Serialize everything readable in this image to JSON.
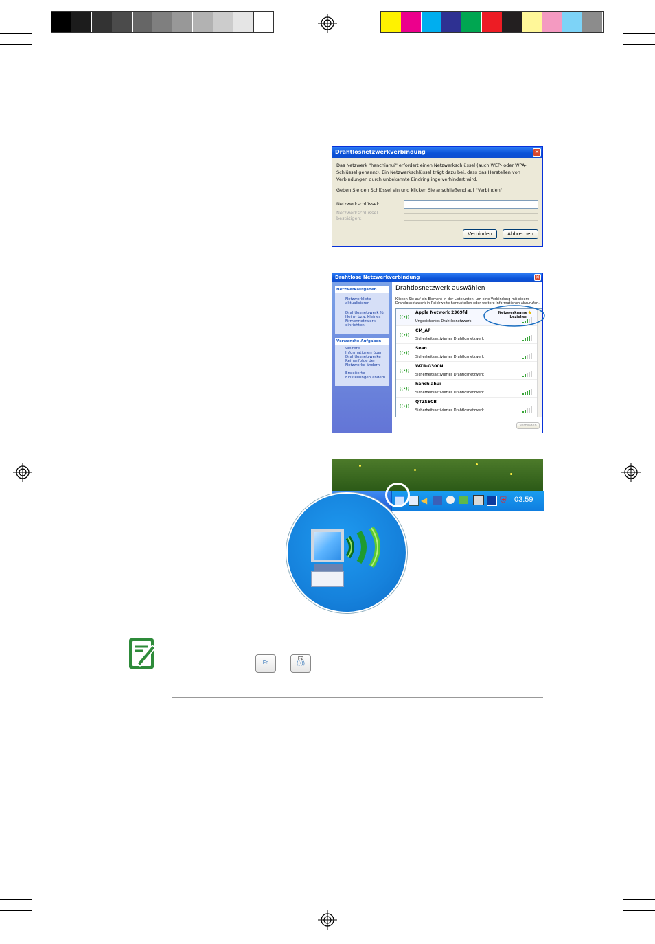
{
  "colors": {
    "gray_bar": [
      "#000000",
      "#1c1c1c",
      "#333333",
      "#4b4b4b",
      "#666666",
      "#7f7f7f",
      "#989898",
      "#b2b2b2",
      "#cccccc",
      "#e5e5e5",
      "#ffffff"
    ],
    "color_bar": [
      "#fff200",
      "#ec008c",
      "#00aeef",
      "#2e3192",
      "#00a651",
      "#ed1c24",
      "#231f20",
      "#fff799",
      "#f49ac1",
      "#7dd3f7",
      "#8c8c8c"
    ],
    "accent": "#0a52d7",
    "note_icon": "#2e8b3a"
  },
  "key_dialog": {
    "title": "Drahtlosnetzwerkverbindung",
    "close": "✕",
    "message": "Das Netzwerk \"hanchiahui\" erfordert einen Netzwerkschlüssel (auch WEP- oder WPA-Schlüssel genannt). Ein Netzwerkschlüssel trägt dazu bei, dass das Herstellen von Verbindungen durch unbekannte Eindringlinge verhindert wird.",
    "instruction": "Geben Sie den Schlüssel ein und klicken Sie anschließend auf \"Verbinden\".",
    "key_label": "Netzwerkschlüssel:",
    "confirm_label": "Netzwerkschlüssel bestätigen:",
    "connect": "Verbinden",
    "cancel": "Abbrechen"
  },
  "select_dialog": {
    "title": "Drahtlose Netzwerkverbindung",
    "close": "✕",
    "heading": "Drahtlosnetzwerk auswählen",
    "intro": "Klicken Sie auf ein Element in der Liste unten, um eine Verbindung mit einem Drahtlosnetzwerk in Reichweite herzustellen oder weitere Informationen abzurufen.",
    "net_tasks_title": "Netzwerkaufgaben",
    "net_tasks": [
      "Netzwerkliste aktualisieren",
      "Drahtlosnetzwerk für Heim- bzw. kleines Firmennetzwerk einrichten"
    ],
    "related_title": "Verwandte Aufgaben",
    "related": [
      "Weitere Informationen über Drahtlosnetzwerke",
      "Reihenfolge der Netzwerke ändern",
      "Erweiterte Einstellungen ändern"
    ],
    "networks": [
      {
        "name": "Apple Network 2369fd",
        "security": "Ungesichertes Drahtlosnetzwerk",
        "signal": 0.5
      },
      {
        "name": "CM_AP",
        "security": "Sicherheitsaktiviertes Drahtlosnetzwerk",
        "signal": 0.8
      },
      {
        "name": "Sean",
        "security": "Sicherheitsaktiviertes Drahtlosnetzwerk",
        "signal": 0.4
      },
      {
        "name": "WZR-G300N",
        "security": "Sicherheitsaktiviertes Drahtlosnetzwerk",
        "signal": 0.4
      },
      {
        "name": "hanchiahui",
        "security": "Sicherheitsaktiviertes Drahtlosnetzwerk",
        "signal": 0.8
      },
      {
        "name": "QTZSECB",
        "security": "Sicherheitsaktiviertes Drahtlosnetzwerk",
        "signal": 0.4
      }
    ],
    "retrieve_name": "Netzwerkname beziehen",
    "connect": "Verbinden"
  },
  "taskbar": {
    "clock": "03.59"
  },
  "note": {
    "key_fn": "Fn",
    "key_f2": "F2"
  }
}
